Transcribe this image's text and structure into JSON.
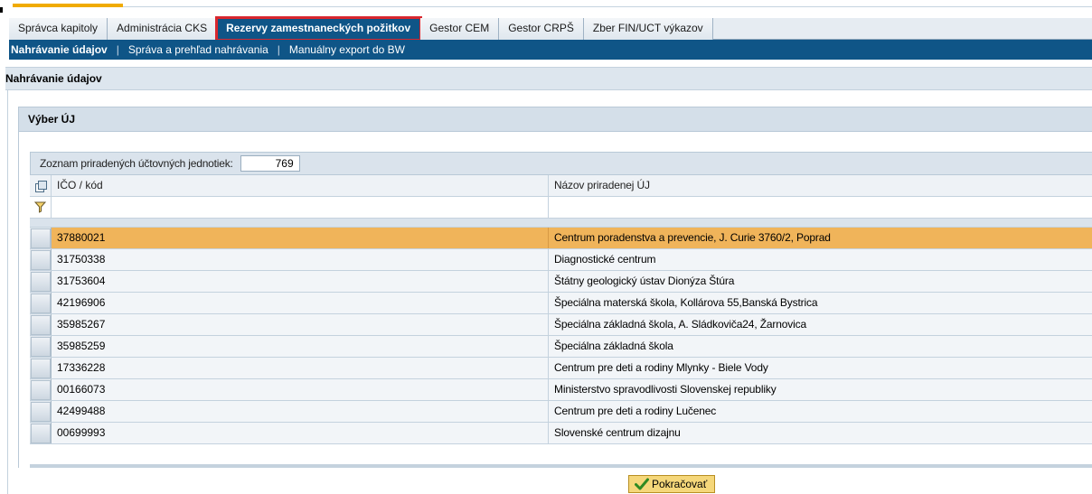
{
  "tabs_l1": [
    {
      "label": "Správca kapitoly",
      "active": false
    },
    {
      "label": "Administrácia CKS",
      "active": false
    },
    {
      "label": "Rezervy zamestnaneckých požitkov",
      "active": true
    },
    {
      "label": "Gestor CEM",
      "active": false
    },
    {
      "label": "Gestor CRPŠ",
      "active": false
    },
    {
      "label": "Zber FIN/UCT výkazov",
      "active": false
    }
  ],
  "tabs_l2": [
    {
      "label": "Nahrávanie údajov",
      "active": true
    },
    {
      "label": "Správa a prehľad nahrávania",
      "active": false
    },
    {
      "label": "Manuálny export do BW",
      "active": false
    }
  ],
  "page_title": "Nahrávanie údajov",
  "group_title": "Výber ÚJ",
  "toolbar": {
    "count_label": "Zoznam priradených účtovných jednotiek:",
    "count_value": "769"
  },
  "table": {
    "columns": [
      "IČO / kód",
      "Názov priradenej ÚJ"
    ],
    "rows": [
      {
        "ico": "37880021",
        "name": "Centrum poradenstva a prevencie, J. Curie 3760/2, Poprad",
        "selected": true
      },
      {
        "ico": "31750338",
        "name": "Diagnostické centrum",
        "selected": false
      },
      {
        "ico": "31753604",
        "name": "Štátny geologický ústav Dionýza Štúra",
        "selected": false
      },
      {
        "ico": "42196906",
        "name": "Špeciálna materská škola, Kollárova 55,Banská Bystrica",
        "selected": false
      },
      {
        "ico": "35985267",
        "name": "Špeciálna základná škola, A. Sládkoviča24,  Žarnovica",
        "selected": false
      },
      {
        "ico": "35985259",
        "name": "Špeciálna základná škola",
        "selected": false
      },
      {
        "ico": "17336228",
        "name": "Centrum pre deti a rodiny Mlynky - Biele Vody",
        "selected": false
      },
      {
        "ico": "00166073",
        "name": "Ministerstvo spravodlivosti Slovenskej republiky",
        "selected": false
      },
      {
        "ico": "42499488",
        "name": "Centrum pre deti a rodiny Lučenec",
        "selected": false
      },
      {
        "ico": "00699993",
        "name": "Slovenské centrum dizajnu",
        "selected": false
      }
    ]
  },
  "continue_button": "Pokračovať",
  "colors": {
    "nav_blue": "#0f5587",
    "selected_row": "#f0b45a",
    "highlight_outline": "#d9272e",
    "accent_orange": "#f0ab00"
  },
  "icons": {
    "column_config": "table-settings-icon",
    "filter": "filter-icon",
    "continue": "checkmark-icon"
  }
}
